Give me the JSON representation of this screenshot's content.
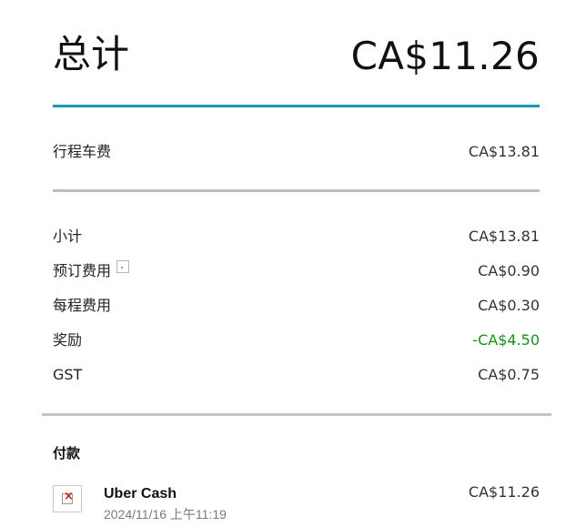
{
  "total": {
    "label": "总计",
    "amount": "CA$11.26"
  },
  "fare": {
    "label": "行程车费",
    "amount": "CA$13.81"
  },
  "breakdown": [
    {
      "label": "小计",
      "amount": "CA$13.81",
      "type": "normal"
    },
    {
      "label": "预订费用",
      "amount": "CA$0.90",
      "type": "normal",
      "has_info_icon": true
    },
    {
      "label": "每程费用",
      "amount": "CA$0.30",
      "type": "normal"
    },
    {
      "label": "奖励",
      "amount": "-CA$4.50",
      "type": "discount"
    },
    {
      "label": "GST",
      "amount": "CA$0.75",
      "type": "normal"
    }
  ],
  "payment": {
    "title": "付款",
    "method": "Uber Cash",
    "datetime": "2024/11/16 上午11:19",
    "amount": "CA$11.26",
    "icon": "broken-image-icon"
  },
  "colors": {
    "accent_rule": "#1a9bb2",
    "discount": "#17911a",
    "divider": "#bdbdbd"
  }
}
